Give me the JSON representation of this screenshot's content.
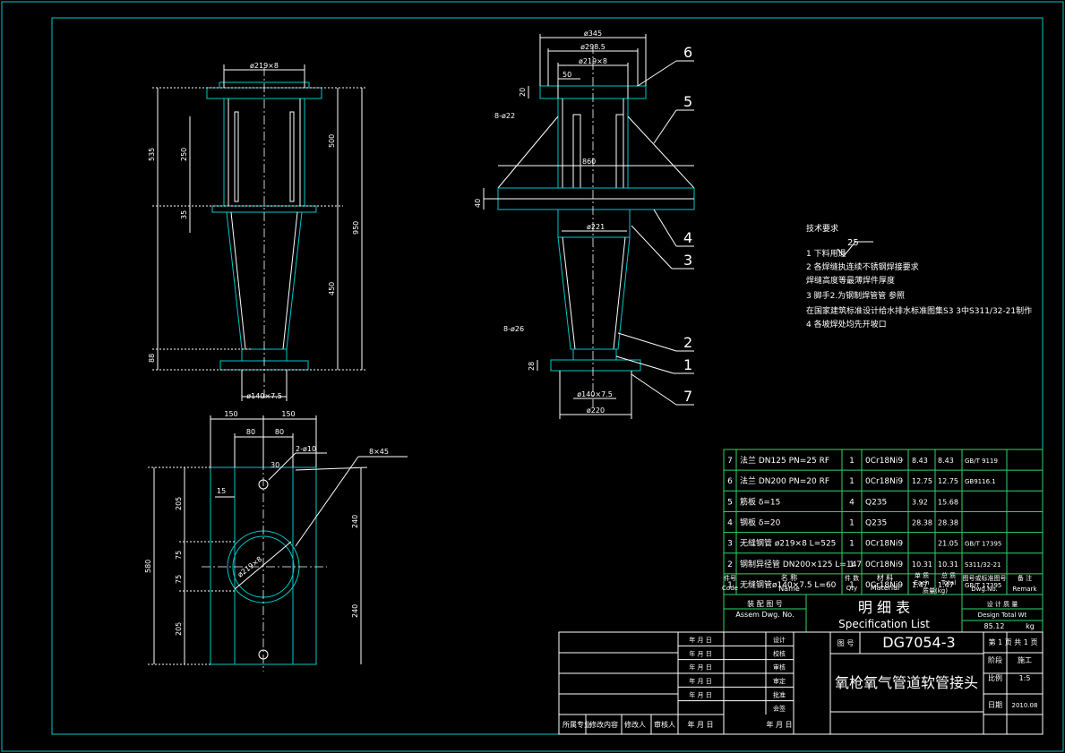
{
  "view_left": {
    "d_top": "ø219×8",
    "d_bottom": "ø140×7.5",
    "dim_535": "535",
    "dim_250": "250",
    "dim_35": "35",
    "dim_500": "500",
    "dim_950": "950",
    "dim_450": "450",
    "dim_88": "88"
  },
  "view_right": {
    "d345": "ø345",
    "d2985": "ø298.5",
    "d219": "ø219×8",
    "d50": "50",
    "t20": "20",
    "holes_top": "8-ø22",
    "d860": "860",
    "t40": "40",
    "d221": "ø221",
    "holes_bottom": "8-ø26",
    "t28": "28",
    "d140": "ø140×7.5",
    "d220": "ø220",
    "balloons": [
      "6",
      "5",
      "4",
      "3",
      "2",
      "1",
      "7"
    ]
  },
  "view_plan": {
    "d150a": "150",
    "d150b": "150",
    "d80a": "80",
    "d80b": "80",
    "d15": "15",
    "d30": "30",
    "holes": "2-ø10",
    "chamfer": "8×45",
    "d580": "580",
    "d205a": "205",
    "d75a": "75",
    "d75b": "75",
    "d205b": "205",
    "d240a": "240",
    "d240b": "240",
    "pipe": "ø219×8"
  },
  "tech_notes": {
    "title": "技术要求",
    "roughness": "25",
    "lines": [
      "1   下料用退",
      "2   各焊缝执连续不锈钢焊接要求",
      "     焊缝高度等最薄焊件厚度",
      "3   脚手2.为钢制焊管管   参照",
      "     在国家建筑标准设计给水排水标准图集S3 3中S311/32-21制作",
      "4   各坡焊处均先开坡口"
    ]
  },
  "bom": {
    "rows": [
      {
        "no": "7",
        "name": "法兰   DN125   PN=25  RF",
        "qty": "1",
        "mat": "0Cr18Ni9",
        "each": "8.43",
        "total": "8.43",
        "std": "GB/T 9119"
      },
      {
        "no": "6",
        "name": "法兰   DN200   PN=20  RF",
        "qty": "1",
        "mat": "0Cr18Ni9",
        "each": "12.75",
        "total": "12.75",
        "std": "GB9116.1"
      },
      {
        "no": "5",
        "name": "筋板          δ=15",
        "qty": "4",
        "mat": "Q235",
        "each": "3.92",
        "total": "15.68",
        "std": ""
      },
      {
        "no": "4",
        "name": "钢板          δ=20",
        "qty": "1",
        "mat": "Q235",
        "each": "28.38",
        "total": "28.38",
        "std": ""
      },
      {
        "no": "3",
        "name": "无缝钢管   ø219×8    L=525",
        "qty": "1",
        "mat": "0Cr18Ni9",
        "each": "",
        "total": "21.05",
        "std": "GB/T 17395"
      },
      {
        "no": "2",
        "name": "钢制异径管  DN200×125   L=147",
        "qty": "1",
        "mat": "0Cr18Ni9",
        "each": "10.31",
        "total": "10.31",
        "std": "S311/32-21"
      },
      {
        "no": "1",
        "name": "无缝钢管ø140×7.5   L=60",
        "qty": "1",
        "mat": "0Cr18Ni9",
        "each": "1.47",
        "total": "1.47",
        "std": "GB/T 17395"
      }
    ],
    "hdr": {
      "no_cn": "件号",
      "no_en": "Code",
      "name_cn": "名        称",
      "name_en": "Name",
      "qty_cn": "件 数",
      "qty_en": "Qty",
      "mat_cn": "材    料",
      "mat_en": "Material",
      "each_cn": "单   质",
      "each_en": "Each",
      "total_cn": "总   质",
      "total_en": "Total",
      "wt_cn": "质量(kg)",
      "wt_en": "(kg)",
      "std_cn": "图号或标准图号",
      "std_en": "Dwg.No.",
      "rem_cn": "备  注",
      "rem_en": "Remark"
    },
    "title_cn": "明    细    表",
    "title_en": "Specification List",
    "assy_cn": "装 配 图 号",
    "assy_en": "Assem Dwg. No.",
    "wt_cn": "设 计 质 量",
    "wt_en": "Design Total Wt",
    "wt_val": "85.12",
    "wt_unit": "kg"
  },
  "title_block": {
    "rows": [
      "年  月  日",
      "年  月  日",
      "年  月  日",
      "年  月  日",
      "年  月  日"
    ],
    "roles": [
      "设计",
      "校核",
      "审核",
      "审定",
      "批准",
      "会签"
    ],
    "dwg_label": "图  号",
    "dwg_no": "DG7054-3",
    "title": "氧枪氧气管道软管接头",
    "sheet": "第 1 页  共 1 页",
    "stage_label": "阶段",
    "stage": "施工",
    "scale_label": "比例",
    "scale": "1:5",
    "date_label": "日期",
    "date": "2010.08",
    "bottom_labels": [
      "所属专业",
      "修改内容",
      "修改人",
      "审核人",
      "年  月  日",
      "年  月  日"
    ]
  }
}
